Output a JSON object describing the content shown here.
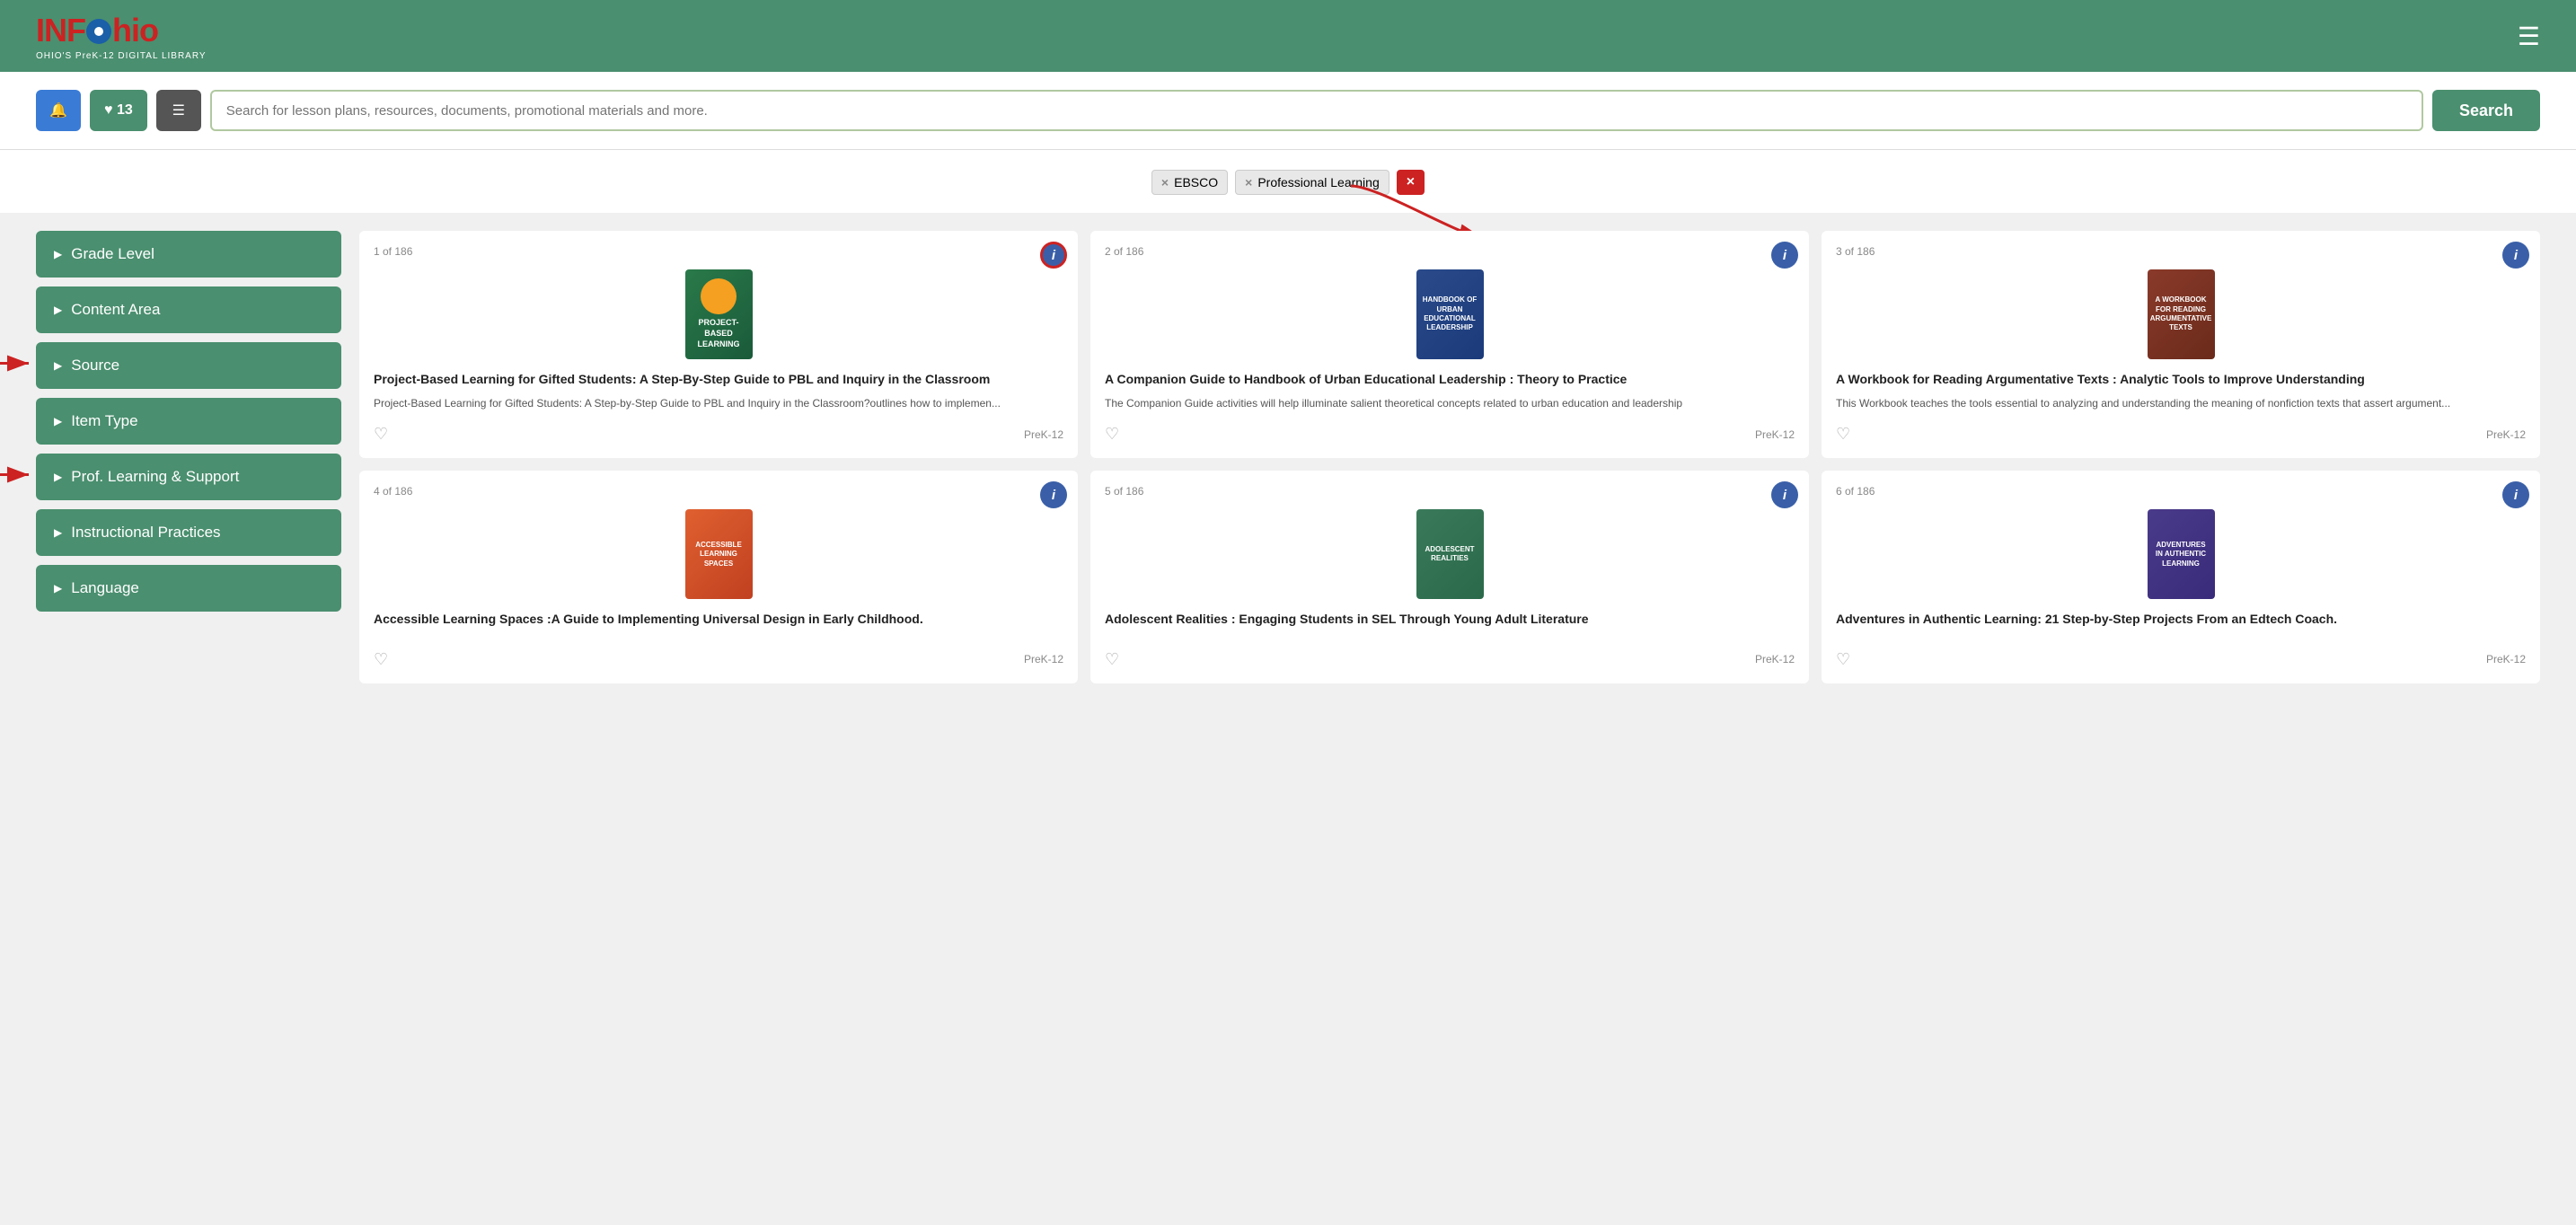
{
  "header": {
    "logo_main": "INFOhio",
    "logo_sub": "OHIO'S PreK-12 DIGITAL LIBRARY",
    "hamburger_label": "☰"
  },
  "toolbar": {
    "bell_label": "🔔",
    "heart_label": "♥ 13",
    "list_label": "☰",
    "search_placeholder": "Search for lesson plans, resources, documents, promotional materials and more.",
    "search_button_label": "Search"
  },
  "filters": {
    "tags": [
      {
        "id": "ebsco",
        "label": "EBSCO",
        "active": false
      },
      {
        "id": "professional-learning",
        "label": "Professional Learning",
        "active": false
      },
      {
        "id": "remove-all",
        "label": "×",
        "active": true
      }
    ]
  },
  "sidebar": {
    "items": [
      {
        "id": "grade-level",
        "label": "Grade Level"
      },
      {
        "id": "content-area",
        "label": "Content Area"
      },
      {
        "id": "source",
        "label": "Source"
      },
      {
        "id": "item-type",
        "label": "Item Type"
      },
      {
        "id": "prof-learning",
        "label": "Prof. Learning & Support"
      },
      {
        "id": "instructional-practices",
        "label": "Instructional Practices"
      },
      {
        "id": "language",
        "label": "Language"
      }
    ],
    "arrow_labels": [
      "→ Source",
      "→ Prof. Learning & Support"
    ]
  },
  "cards": [
    {
      "id": "card-1",
      "count": "1 of 186",
      "title": "Project-Based Learning for Gifted Students: A Step-By-Step Guide to PBL and Inquiry in the Classroom",
      "description": "Project-Based Learning for Gifted Students: A Step-by-Step Guide to PBL and Inquiry in the Classroom?outlines how to implemen...",
      "grade": "PreK-12",
      "info_highlighted": true,
      "book_class": "book-1",
      "book_label": "PROJECT-\nBASED\nLEARNING"
    },
    {
      "id": "card-2",
      "count": "2 of 186",
      "title": "A Companion Guide to Handbook of Urban Educational Leadership : Theory to Practice",
      "description": "The Companion Guide activities will help illuminate salient theoretical concepts related to urban education and leadership",
      "grade": "PreK-12",
      "info_highlighted": false,
      "book_class": "book-2",
      "book_label": "HANDBOOK\nURBAN\nLEADERSHIP"
    },
    {
      "id": "card-3",
      "count": "3 of 186",
      "title": "A Workbook for Reading Argumentative Texts : Analytic Tools to Improve Understanding",
      "description": "This Workbook teaches the tools essential to analyzing and understanding the meaning of nonfiction texts that assert argument...",
      "grade": "PreK-12",
      "info_highlighted": false,
      "book_class": "book-3",
      "book_label": "READING\nARGUMENTATIVE\nTEXTS"
    },
    {
      "id": "card-4",
      "count": "4 of 186",
      "title": "Accessible Learning Spaces :A Guide to Implementing Universal Design in Early Childhood.",
      "description": "",
      "grade": "PreK-12",
      "info_highlighted": false,
      "book_class": "book-4",
      "book_label": "ACCESSIBLE\nLEARNING\nSPACES"
    },
    {
      "id": "card-5",
      "count": "5 of 186",
      "title": "Adolescent Realities : Engaging Students in SEL Through Young Adult Literature",
      "description": "",
      "grade": "PreK-12",
      "info_highlighted": false,
      "book_class": "book-5",
      "book_label": "ADOLESCENT\nREALITIES"
    },
    {
      "id": "card-6",
      "count": "6 of 186",
      "title": "Adventures in Authentic Learning: 21 Step-by-Step Projects From an Edtech Coach.",
      "description": "",
      "grade": "PreK-12",
      "info_highlighted": false,
      "book_class": "book-6",
      "book_label": "ADVENTURES\nAUTHENTIC\nLEARNING"
    }
  ]
}
